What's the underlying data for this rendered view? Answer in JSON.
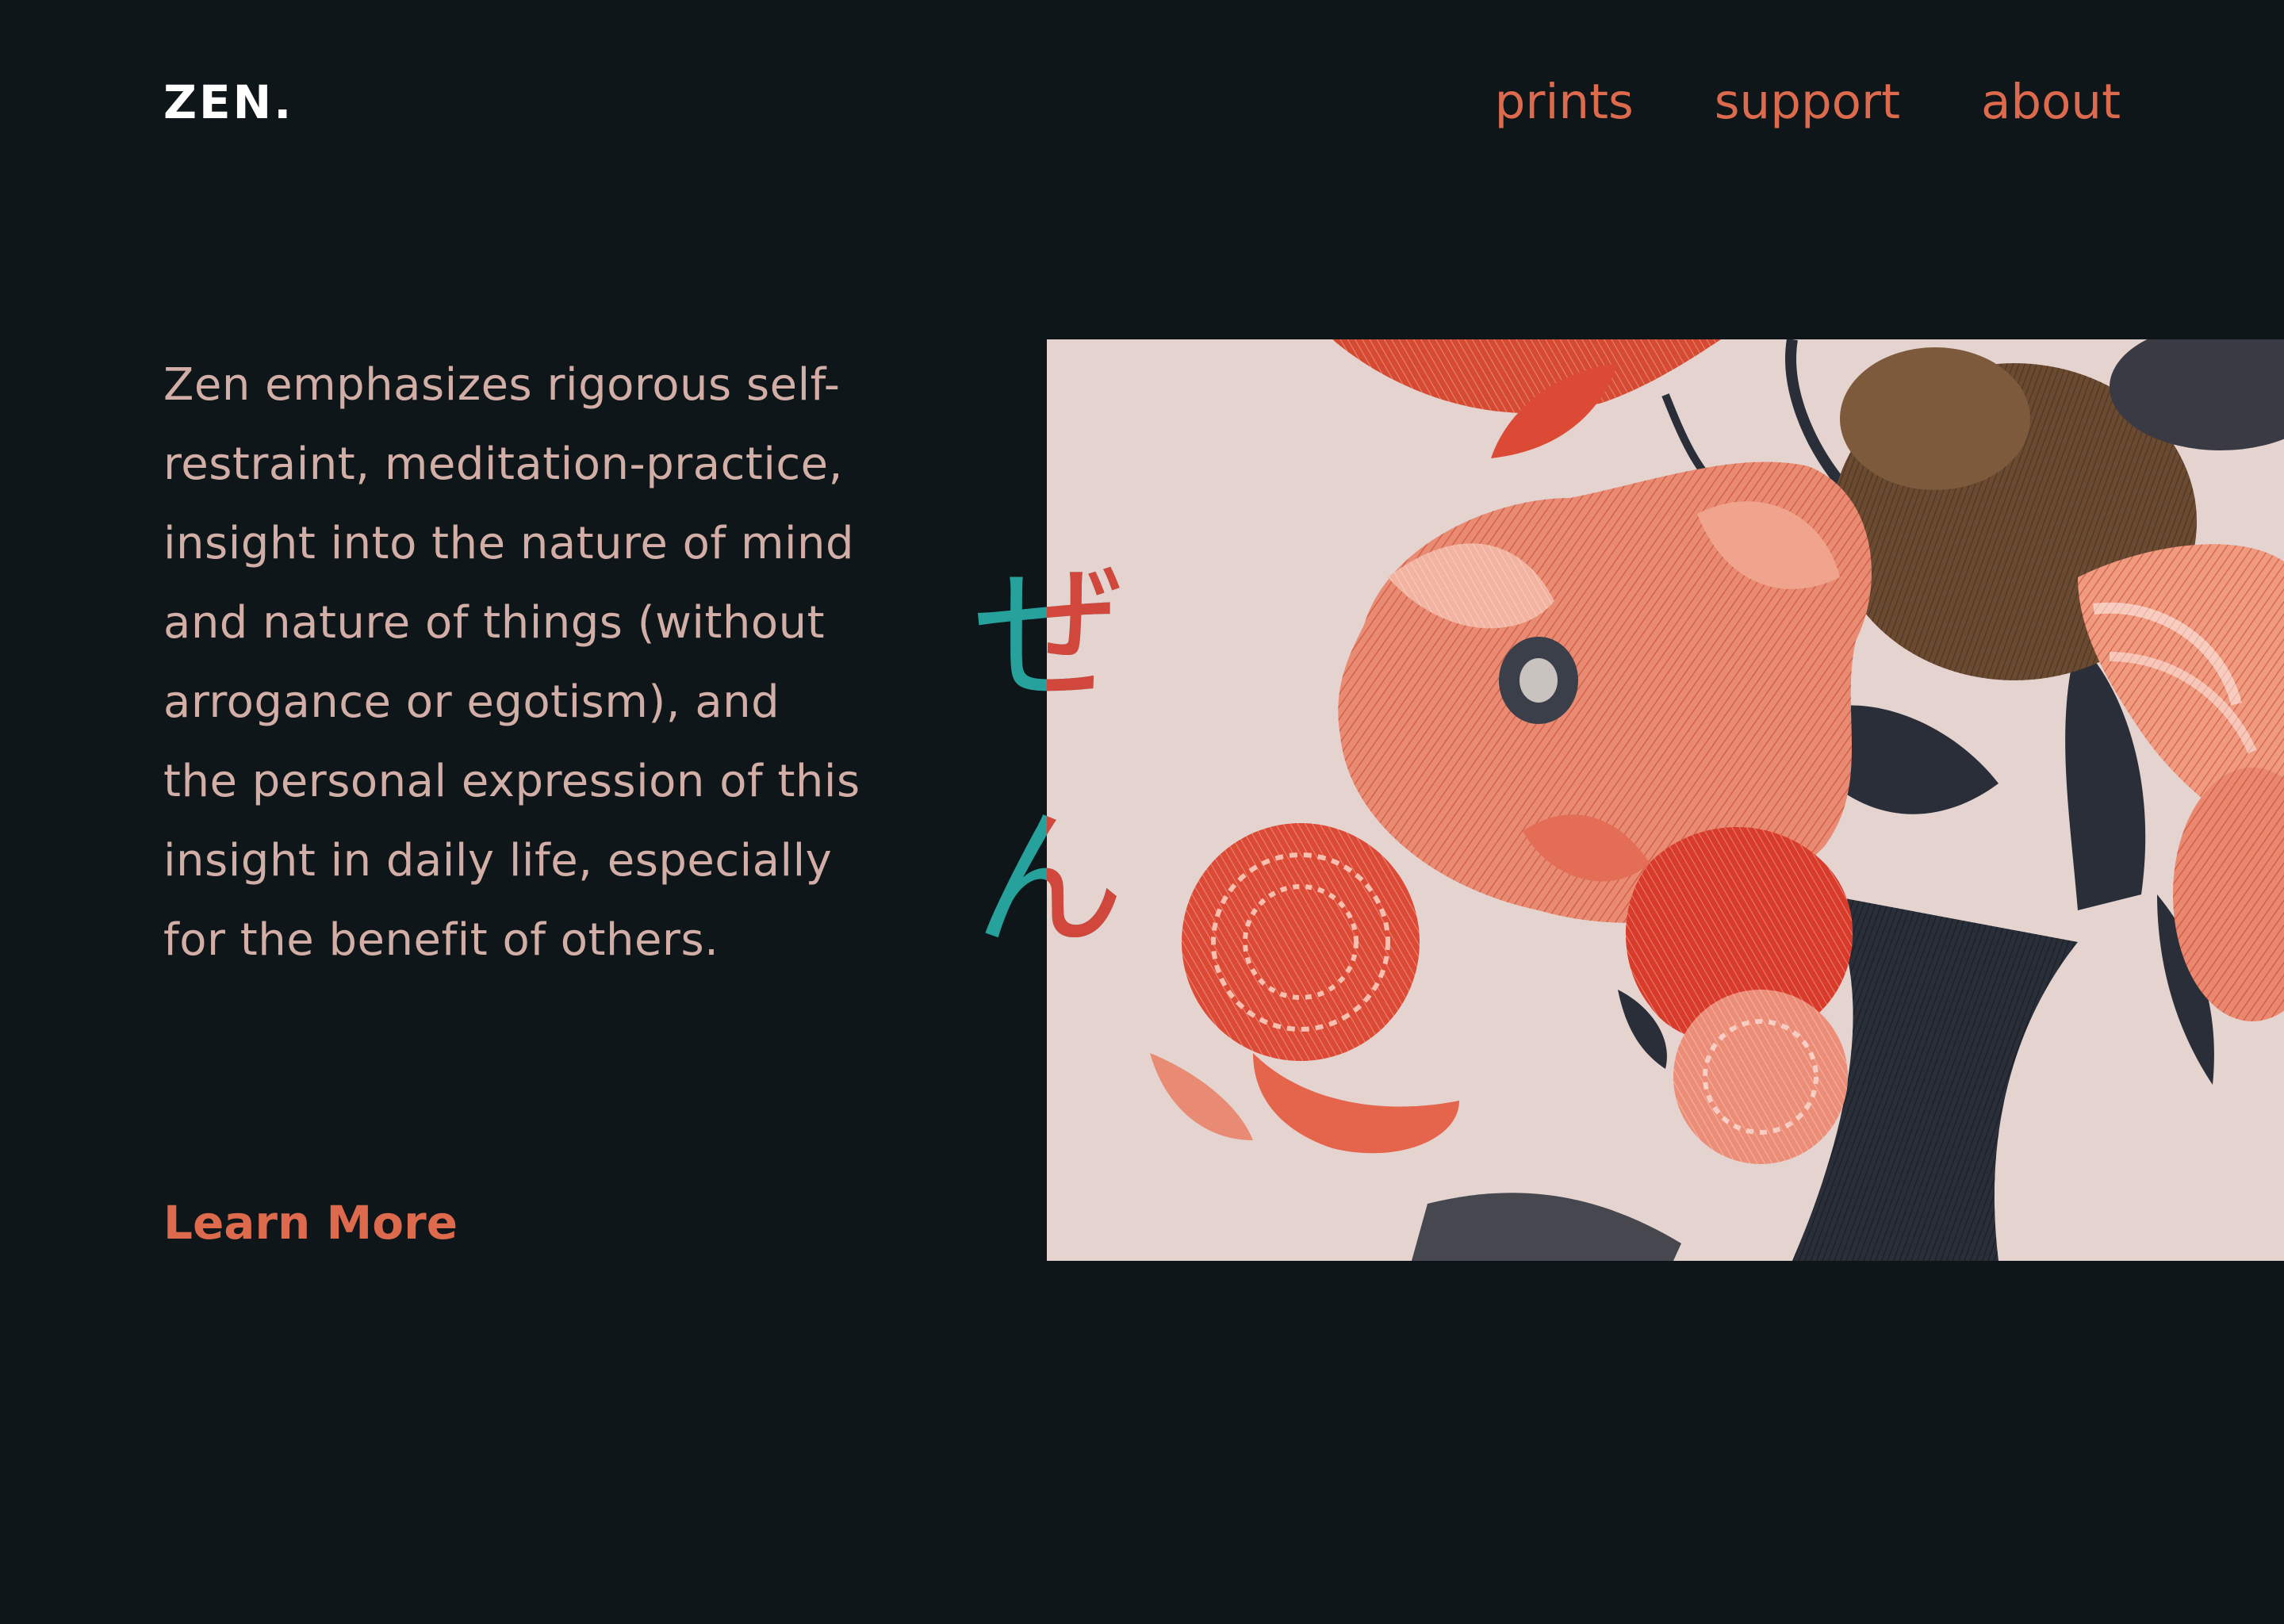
{
  "brand": {
    "logo": "ZEN."
  },
  "nav": {
    "items": [
      {
        "label": "prints"
      },
      {
        "label": "support"
      },
      {
        "label": "about"
      }
    ]
  },
  "main": {
    "paragraph": "Zen emphasizes rigorous self-restraint, meditation-practice, insight into the nature of mind and nature of things (without arrogance or egotism), and the personal expression of this insight in daily life, especially for the benefit of others.",
    "cta_label": "Learn More"
  },
  "vertical_title": {
    "char_1": "ぜ",
    "char_2": "ん"
  },
  "hero_image": {
    "subject": "engraved floral still-life illustration"
  },
  "colors": {
    "background": "#0e1619",
    "accent": "#de6a4e",
    "body_text": "#d2aea6",
    "logo": "#ffffff",
    "kana_teal": "#27a19c",
    "kana_red": "#d2473c",
    "image_paper": "#e4d3cf"
  }
}
